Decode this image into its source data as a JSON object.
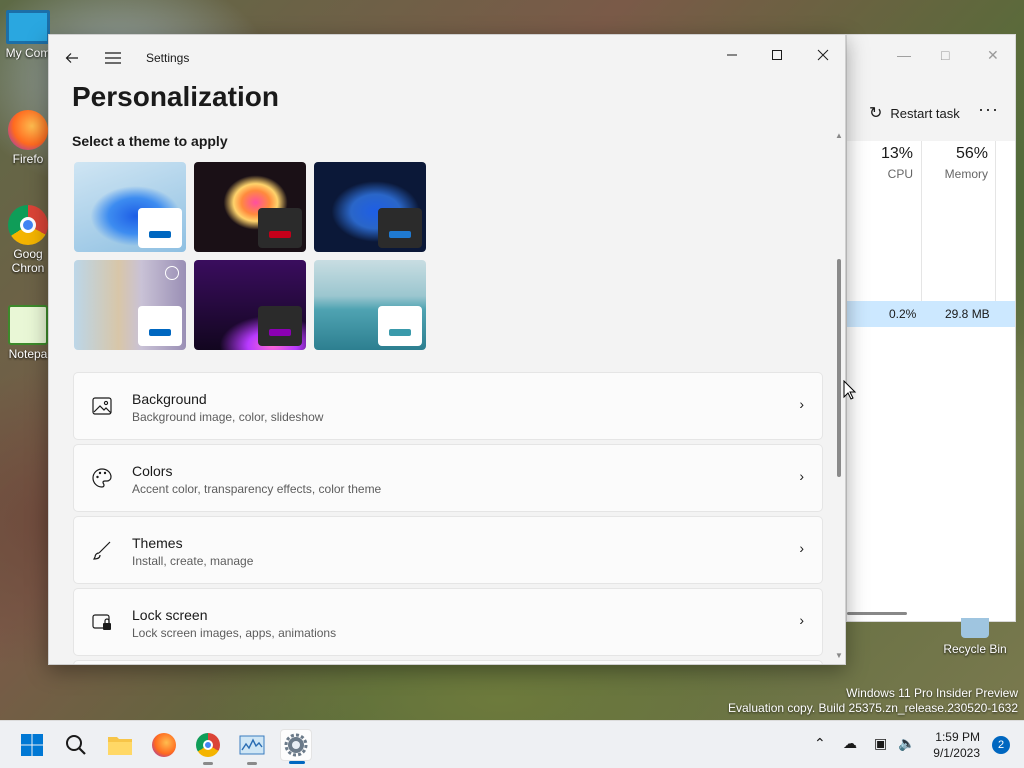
{
  "desktop": {
    "icons": [
      {
        "label": "My Com",
        "icon": "computer-icon"
      },
      {
        "label": "Firefo",
        "icon": "firefox-icon"
      },
      {
        "label": "Goog",
        "label2": "Chron",
        "icon": "chrome-icon"
      },
      {
        "label": "Notepa",
        "icon": "notepad-icon"
      }
    ],
    "recycle_bin": "Recycle Bin",
    "watermark_line1": "Windows 11 Pro Insider Preview",
    "watermark_line2": "Evaluation copy. Build 25375.zn_release.230520-1632"
  },
  "taskmgr": {
    "restart_label": "Restart task",
    "more_label": "···",
    "cpu_pct": "13%",
    "cpu_label": "CPU",
    "mem_pct": "56%",
    "mem_label": "Memory",
    "row_cpu": "0.2%",
    "row_mem": "29.8 MB"
  },
  "settings": {
    "window_title": "Settings",
    "page_title": "Personalization",
    "themes_heading": "Select a theme to apply",
    "themes": [
      {
        "name": "windows-light",
        "bg": "#a9cfe6",
        "swatch": "#ffffff",
        "bar": "#0067c0"
      },
      {
        "name": "glow",
        "bg": "#1a1016",
        "swatch": "#2b2b2b",
        "bar": "#c4001a"
      },
      {
        "name": "windows-dark",
        "bg": "#11214a",
        "swatch": "#2b2b2b",
        "bar": "#1f7ad1"
      },
      {
        "name": "captured-motion",
        "bg": "#c9c2d6",
        "swatch": "#ffffff",
        "bar": "#0067c0"
      },
      {
        "name": "sunrise",
        "bg": "#2a0a45",
        "swatch": "#2b2b2b",
        "bar": "#8b00b3"
      },
      {
        "name": "flow",
        "bg": "#5ea7b3",
        "swatch": "#ffffff",
        "bar": "#3a9aab"
      }
    ],
    "cards": [
      {
        "title": "Background",
        "subtitle": "Background image, color, slideshow",
        "icon": "image-icon"
      },
      {
        "title": "Colors",
        "subtitle": "Accent color, transparency effects, color theme",
        "icon": "palette-icon"
      },
      {
        "title": "Themes",
        "subtitle": "Install, create, manage",
        "icon": "brush-icon"
      },
      {
        "title": "Lock screen",
        "subtitle": "Lock screen images, apps, animations",
        "icon": "lock-screen-icon"
      }
    ]
  },
  "taskbar": {
    "apps": [
      "start-icon",
      "search-icon",
      "file-explorer-icon",
      "firefox-icon",
      "chrome-icon",
      "task-manager-icon",
      "settings-icon"
    ],
    "time": "1:59 PM",
    "date": "9/1/2023",
    "notification_count": "2"
  },
  "colors": {
    "accent": "#0067c0"
  }
}
